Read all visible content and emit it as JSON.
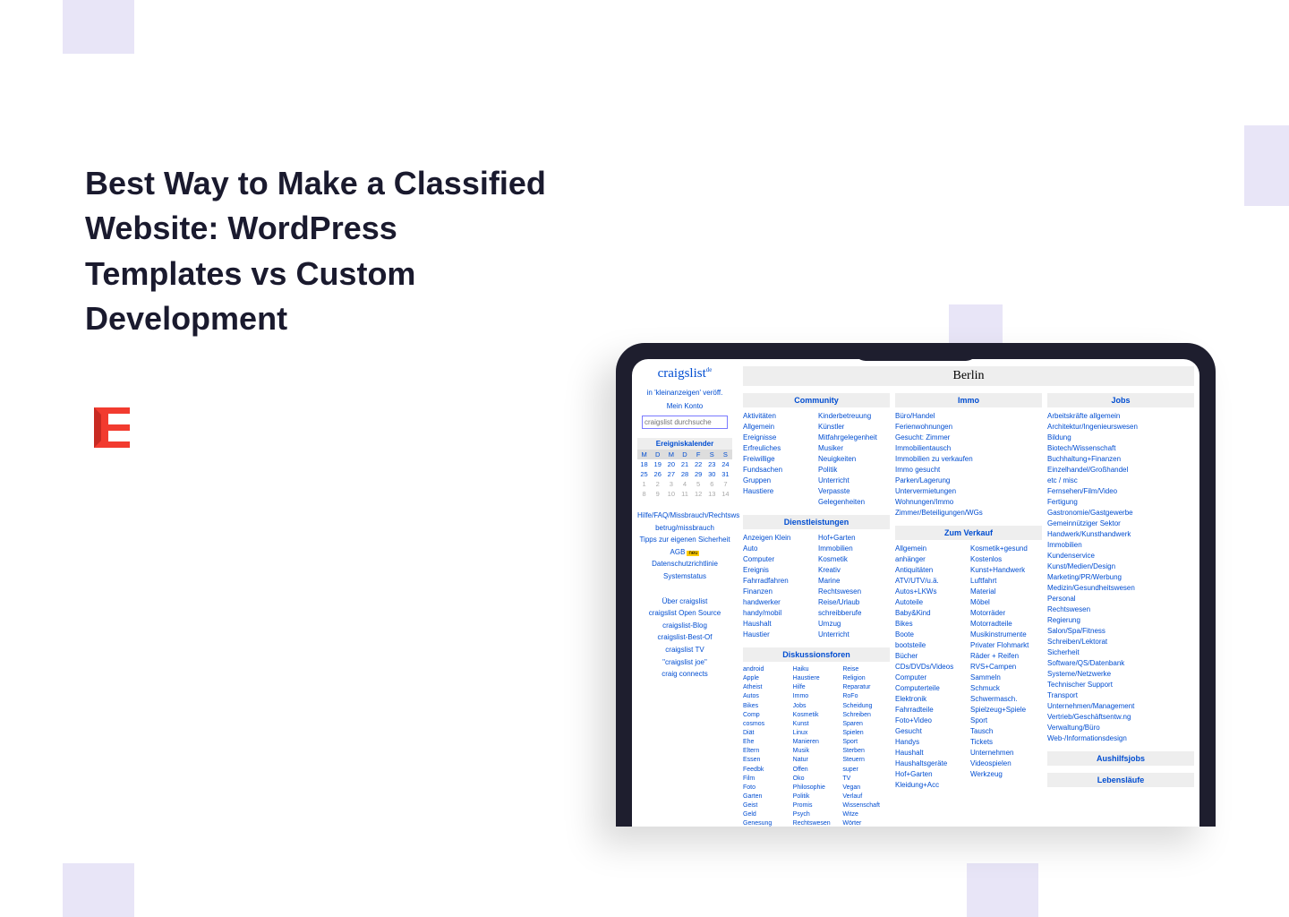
{
  "headline": "Best Way to Make a Classified Website: WordPress Templates vs Custom Development",
  "craigslist": {
    "brand": "craigslist",
    "brand_sup": "de",
    "post_link": "in 'kleinanzeigen' veröff.",
    "account": "Mein Konto",
    "search_placeholder": "craigslist durchsuche",
    "cal_title": "Ereigniskalender",
    "cal_headers": [
      "M",
      "D",
      "M",
      "D",
      "F",
      "S",
      "S"
    ],
    "cal_rows": [
      [
        "18",
        "19",
        "20",
        "21",
        "22",
        "23",
        "24"
      ],
      [
        "25",
        "26",
        "27",
        "28",
        "29",
        "30",
        "31"
      ],
      [
        "1",
        "2",
        "3",
        "4",
        "5",
        "6",
        "7"
      ],
      [
        "8",
        "9",
        "10",
        "11",
        "12",
        "13",
        "14"
      ]
    ],
    "side_links_1": [
      "Hilfe/FAQ/Missbrauch/Rechtsws",
      "betrug/missbrauch",
      "Tipps zur eigenen Sicherheit",
      "AGB",
      "Datenschutzrichtlinie",
      "Systemstatus"
    ],
    "agb_badge": "neu",
    "side_links_2": [
      "Über craigslist",
      "craigslist Open Source",
      "craigslist-Blog",
      "craigslist-Best-Of",
      "craigslist TV",
      "\"craigslist joe\"",
      "craig connects"
    ],
    "city": "Berlin",
    "sections": {
      "community": {
        "title": "Community",
        "col1": [
          "Aktivitäten",
          "Allgemein",
          "Ereignisse",
          "Erfreuliches",
          "Freiwillige",
          "Fundsachen",
          "Gruppen",
          "Haustiere"
        ],
        "col2": [
          "Kinderbetreuung",
          "Künstler",
          "Mitfahrgelegenheit",
          "Musiker",
          "Neuigkeiten",
          "Politik",
          "Unterricht",
          "Verpasste",
          "Gelegenheiten"
        ]
      },
      "services": {
        "title": "Dienstleistungen",
        "col1": [
          "Anzeigen Klein",
          "Auto",
          "Computer",
          "Ereignis",
          "Fahrradfahren",
          "Finanzen",
          "handwerker",
          "handy/mobil",
          "Haushalt",
          "Haustier"
        ],
        "col2": [
          "Hof+Garten",
          "Immobilien",
          "Kosmetik",
          "Kreativ",
          "Marine",
          "Rechtswesen",
          "Reise/Urlaub",
          "schreibberufe",
          "Umzug",
          "Unterricht"
        ]
      },
      "forums": {
        "title": "Diskussionsforen",
        "col1": [
          "android",
          "Apple",
          "Atheist",
          "Autos",
          "Bikes",
          "Comp",
          "cosmos",
          "Diät",
          "Ehe",
          "Eltern",
          "Essen",
          "Feedbk",
          "Film",
          "Foto",
          "Garten",
          "Geist",
          "Geld",
          "Genesung"
        ],
        "col2": [
          "Haiku",
          "Haustiere",
          "Hilfe",
          "Immo",
          "Jobs",
          "Kosmetik",
          "Kunst",
          "Linux",
          "Manieren",
          "Musik",
          "Natur",
          "Offen",
          "Öko",
          "Philosophie",
          "Politik",
          "Promis",
          "Psych",
          "Rechtswesen"
        ],
        "col3": [
          "Reise",
          "Religion",
          "Reparatur",
          "RoFo",
          "Scheidung",
          "Schreiben",
          "Sparen",
          "Spielen",
          "Sport",
          "Sterben",
          "Steuern",
          "super",
          "TV",
          "Vegan",
          "Verlauf",
          "Wissenschaft",
          "Witze",
          "Wörter"
        ]
      },
      "immo": {
        "title": "Immo",
        "items": [
          "Büro/Handel",
          "Ferienwohnungen",
          "Gesucht: Zimmer",
          "Immobilientausch",
          "Immobilien zu verkaufen",
          "Immo gesucht",
          "Parken/Lagerung",
          "Untervermietungen",
          "Wohnungen/Immo",
          "Zimmer/Beteiligungen/WGs"
        ]
      },
      "sale": {
        "title": "Zum Verkauf",
        "col1": [
          "Allgemein",
          "anhänger",
          "Antiquitäten",
          "ATV/UTV/u.ä.",
          "Autos+LKWs",
          "Autoteile",
          "Baby&Kind",
          "Bikes",
          "Boote",
          "bootsteile",
          "Bücher",
          "CDs/DVDs/Videos",
          "Computer",
          "Computerteile",
          "Elektronik",
          "Fahrradteile",
          "Foto+Video",
          "Gesucht",
          "Handys",
          "Haushalt",
          "Haushaltsgeräte",
          "Hof+Garten",
          "Kleidung+Acc"
        ],
        "col2": [
          "Kosmetik+gesund",
          "Kostenlos",
          "Kunst+Handwerk",
          "Luftfahrt",
          "Material",
          "Möbel",
          "Motorräder",
          "Motorradteile",
          "Musikinstrumente",
          "Privater Flohmarkt",
          "Räder + Reifen",
          "RVS+Campen",
          "Sammeln",
          "Schmuck",
          "Schwermasch.",
          "Spielzeug+Spiele",
          "Sport",
          "Tausch",
          "Tickets",
          "Unternehmen",
          "Videospielen",
          "Werkzeug"
        ]
      },
      "jobs": {
        "title": "Jobs",
        "items": [
          "Arbeitskräfte allgemein",
          "Architektur/Ingenieurswesen",
          "Bildung",
          "Biotech/Wissenschaft",
          "Buchhaltung+Finanzen",
          "Einzelhandel/Großhandel",
          "etc / misc",
          "Fernsehen/Film/Video",
          "Fertigung",
          "Gastronomie/Gastgewerbe",
          "Gemeinnütziger Sektor",
          "Handwerk/Kunsthandwerk",
          "Immobilien",
          "Kundenservice",
          "Kunst/Medien/Design",
          "Marketing/PR/Werbung",
          "Medizin/Gesundheitswesen",
          "Personal",
          "Rechtswesen",
          "Regierung",
          "Salon/Spa/Fitness",
          "Schreiben/Lektorat",
          "Sicherheit",
          "Software/QS/Datenbank",
          "Systeme/Netzwerke",
          "Technischer Support",
          "Transport",
          "Unternehmen/Management",
          "Vertrieb/Geschäftsentw.ng",
          "Verwaltung/Büro",
          "Web-/Informationsdesign"
        ]
      },
      "gigs": {
        "title": "Aushilfsjobs"
      },
      "resumes": {
        "title": "Lebensläufe"
      }
    }
  }
}
